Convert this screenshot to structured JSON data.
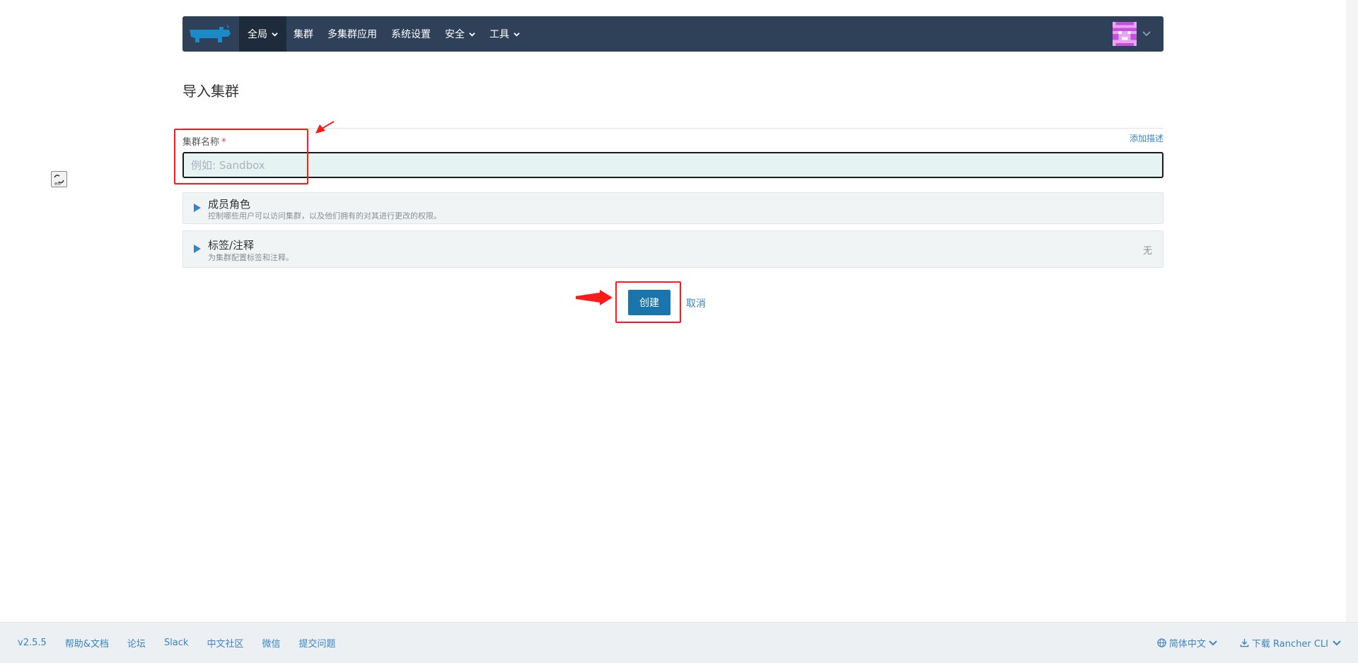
{
  "header": {
    "nav": [
      {
        "label": "全局",
        "dropdown": true,
        "active": true
      },
      {
        "label": "集群",
        "dropdown": false
      },
      {
        "label": "多集群应用",
        "dropdown": false
      },
      {
        "label": "系统设置",
        "dropdown": false
      },
      {
        "label": "安全",
        "dropdown": true
      },
      {
        "label": "工具",
        "dropdown": true
      }
    ],
    "brand_color": "#2f4159"
  },
  "page": {
    "title": "导入集群"
  },
  "form": {
    "cluster_name_label": "集群名称",
    "required_mark": "*",
    "cluster_name_placeholder": "例如: Sandbox",
    "cluster_name_value": "",
    "add_description": "添加描述"
  },
  "accordions": [
    {
      "title": "成员角色",
      "subtitle": "控制哪些用户可以访问集群，以及他们拥有的对其进行更改的权限。",
      "status": ""
    },
    {
      "title": "标签/注释",
      "subtitle": "为集群配置标签和注释。",
      "status": "无"
    }
  ],
  "actions": {
    "create_label": "创建",
    "cancel_label": "取消"
  },
  "footer": {
    "version": "v2.5.5",
    "links": [
      "帮助&文档",
      "论坛",
      "Slack",
      "中文社区",
      "微信",
      "提交问题"
    ],
    "language": "简体中文",
    "download_cli": "下载 Rancher CLI"
  },
  "colors": {
    "primary": "#1a75ac",
    "link": "#3b84c4",
    "annotation": "#ff1a1a"
  }
}
